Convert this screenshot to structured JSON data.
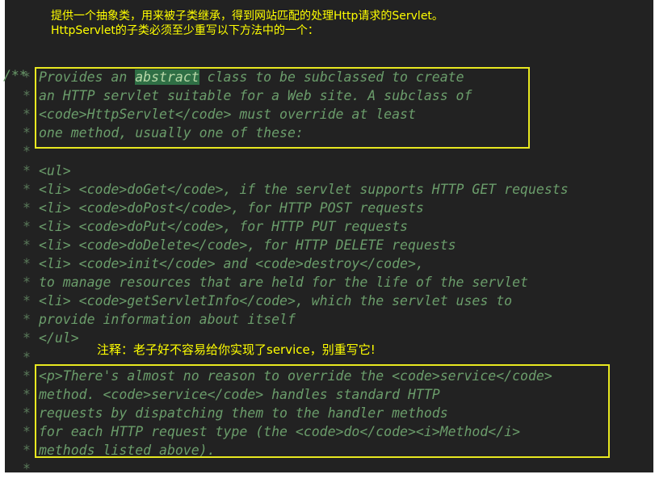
{
  "note_top": {
    "line1": "提供一个抽象类，用来被子类继承，得到网站匹配的处理Http请求的Servlet。",
    "line2": "HttpServlet的子类必须至少重写以下方法中的一个："
  },
  "comment_open": "/**",
  "lines": [
    {
      "star": "*",
      "text": "Provides an "
    },
    {
      "star": "*",
      "text": "an HTTP servlet suitable for a Web site. A subclass of"
    },
    {
      "star": "*",
      "text": "<code>HttpServlet</code> must override at least"
    },
    {
      "star": "*",
      "text": "one method, usually one of these:"
    },
    {
      "star": "*",
      "text": ""
    },
    {
      "star": "*",
      "text": "<ul>"
    },
    {
      "star": "*",
      "text": "<li> <code>doGet</code>, if the servlet supports HTTP GET requests"
    },
    {
      "star": "*",
      "text": "<li> <code>doPost</code>, for HTTP POST requests"
    },
    {
      "star": "*",
      "text": "<li> <code>doPut</code>, for HTTP PUT requests"
    },
    {
      "star": "*",
      "text": "<li> <code>doDelete</code>, for HTTP DELETE requests"
    },
    {
      "star": "*",
      "text": "<li> <code>init</code> and <code>destroy</code>,"
    },
    {
      "star": "*",
      "text": "to manage resources that are held for the life of the servlet"
    },
    {
      "star": "*",
      "text": "<li> <code>getServletInfo</code>, which the servlet uses to"
    },
    {
      "star": "*",
      "text": "provide information about itself"
    },
    {
      "star": "*",
      "text": "</ul>"
    },
    {
      "star": "*",
      "text": ""
    },
    {
      "star": "*",
      "text": "<p>There's almost no reason to override the <code>service</code>"
    },
    {
      "star": "*",
      "text": "method. <code>service</code> handles standard HTTP"
    },
    {
      "star": "*",
      "text": "requests by dispatching them to the handler methods"
    },
    {
      "star": "*",
      "text": "for each HTTP request type (the <code>do</code><i>Method</i>"
    },
    {
      "star": "*",
      "text": "methods listed above)."
    },
    {
      "star": "*",
      "text": ""
    }
  ],
  "highlight_word": "abstract",
  "line1_tail": " class to be subclassed to create",
  "note_service": "注释：老子好不容易给你实现了service，别重写它!"
}
